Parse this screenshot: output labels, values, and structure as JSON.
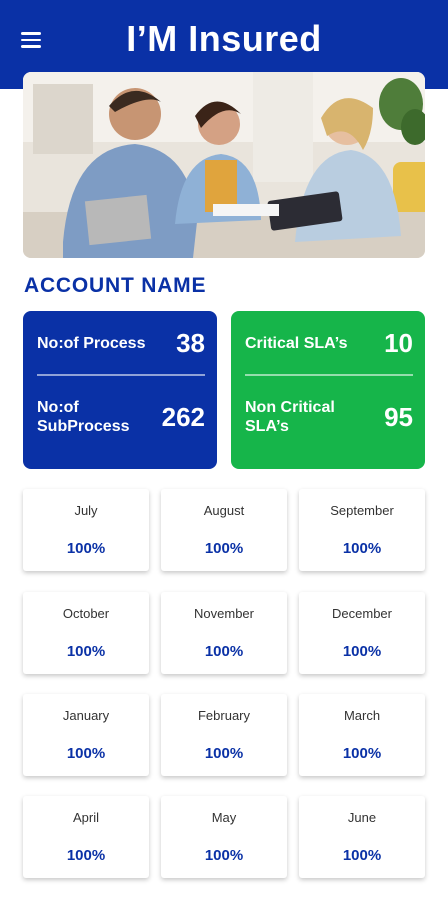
{
  "header": {
    "title": "I’M Insured",
    "menu_icon": "hamburger-menu-icon"
  },
  "hero": {
    "image": "people-meeting-photo"
  },
  "account": {
    "title": "ACCOUNT NAME"
  },
  "stats": {
    "process": {
      "label": "No:of Process",
      "value": "38"
    },
    "subprocess": {
      "label_line1": "No:of",
      "label_line2": "SubProcess",
      "value": "262"
    },
    "critical_sla": {
      "label": "Critical SLA’s",
      "value": "10"
    },
    "non_critical_sla": {
      "label_line1": "Non Critical",
      "label_line2": "SLA’s",
      "value": "95"
    }
  },
  "months": [
    {
      "name": "July",
      "value": "100%"
    },
    {
      "name": "August",
      "value": "100%"
    },
    {
      "name": "September",
      "value": "100%"
    },
    {
      "name": "October",
      "value": "100%"
    },
    {
      "name": "November",
      "value": "100%"
    },
    {
      "name": "December",
      "value": "100%"
    },
    {
      "name": "January",
      "value": "100%"
    },
    {
      "name": "February",
      "value": "100%"
    },
    {
      "name": "March",
      "value": "100%"
    },
    {
      "name": "April",
      "value": "100%"
    },
    {
      "name": "May",
      "value": "100%"
    },
    {
      "name": "June",
      "value": "100%"
    }
  ],
  "colors": {
    "brand_blue": "#0a31a6",
    "green": "#16b54a"
  }
}
